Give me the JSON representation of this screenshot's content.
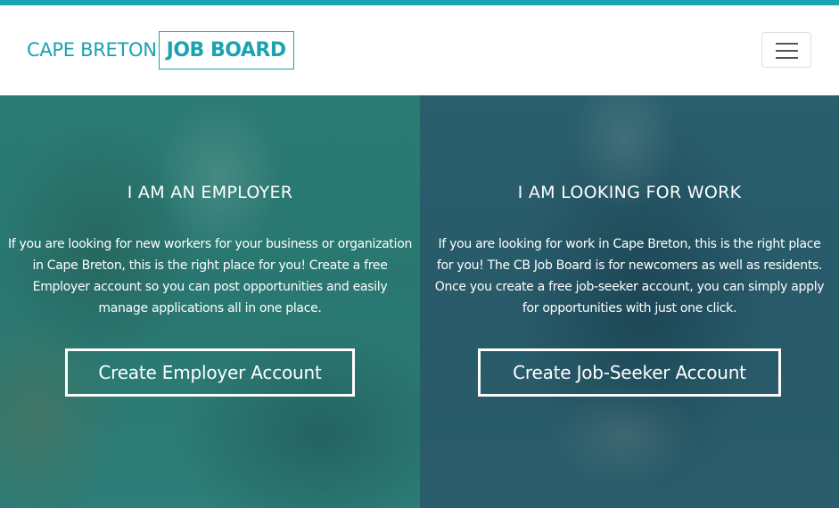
{
  "brand": {
    "name_part1": "CAPE BRETON",
    "name_part2": "JOB BOARD",
    "accent_color": "#1aa3b0"
  },
  "header": {
    "menu_icon": "hamburger-menu-icon"
  },
  "employer": {
    "title": "I AM AN EMPLOYER",
    "description": "If you are looking for new workers for your business or organization in Cape Breton, this is the right place for you! Create a free Employer account so you can post opportunities and easily manage applications all in one place.",
    "button_label": "Create Employer Account",
    "overlay_color": "#2b7a74"
  },
  "job_seeker": {
    "title": "I AM LOOKING FOR WORK",
    "description": "If you are looking for work in Cape Breton, this is the right place for you! The CB Job Board is for newcomers as well as residents. Once you create a free job-seeker account, you can simply apply for opportunities with just one click.",
    "button_label": "Create Job-Seeker Account",
    "overlay_color": "#2a5f6e"
  }
}
